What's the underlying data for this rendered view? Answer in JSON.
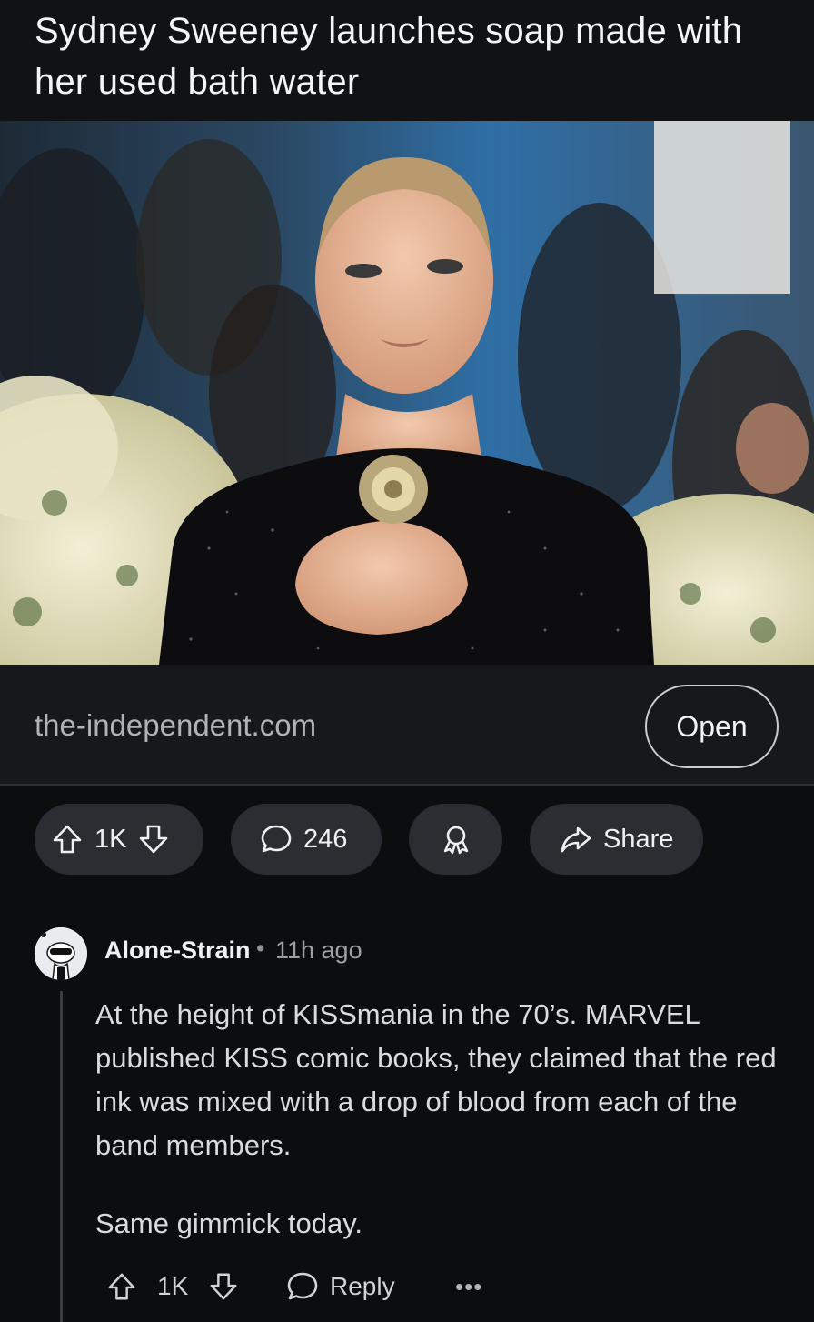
{
  "post": {
    "title": "Sydney Sweeney launches soap made with her used bath water",
    "link_domain": "the-independent.com",
    "open_label": "Open",
    "vote_count": "1K",
    "comment_count": "246",
    "share_label": "Share"
  },
  "icons": {
    "upvote": "upvote-arrow-icon",
    "downvote": "downvote-arrow-icon",
    "comments": "speech-bubble-icon",
    "award": "award-ribbon-icon",
    "share": "share-arrow-icon",
    "more": "more-dots-icon"
  },
  "comment": {
    "author": "Alone-Strain",
    "separator": "•",
    "age": "11h ago",
    "paragraphs": [
      "At the height of KISSmania in the 70’s. MARVEL published KISS comic books, they claimed that the red ink was mixed with a drop of blood from each of the band members.",
      "Same gimmick today."
    ],
    "vote_count": "1K",
    "reply_label": "Reply",
    "more_label": "•••"
  },
  "colors": {
    "background": "#0c0d0f",
    "pill": "#2a2d31",
    "text": "#e6e8ea",
    "muted": "#9aa0a6"
  }
}
